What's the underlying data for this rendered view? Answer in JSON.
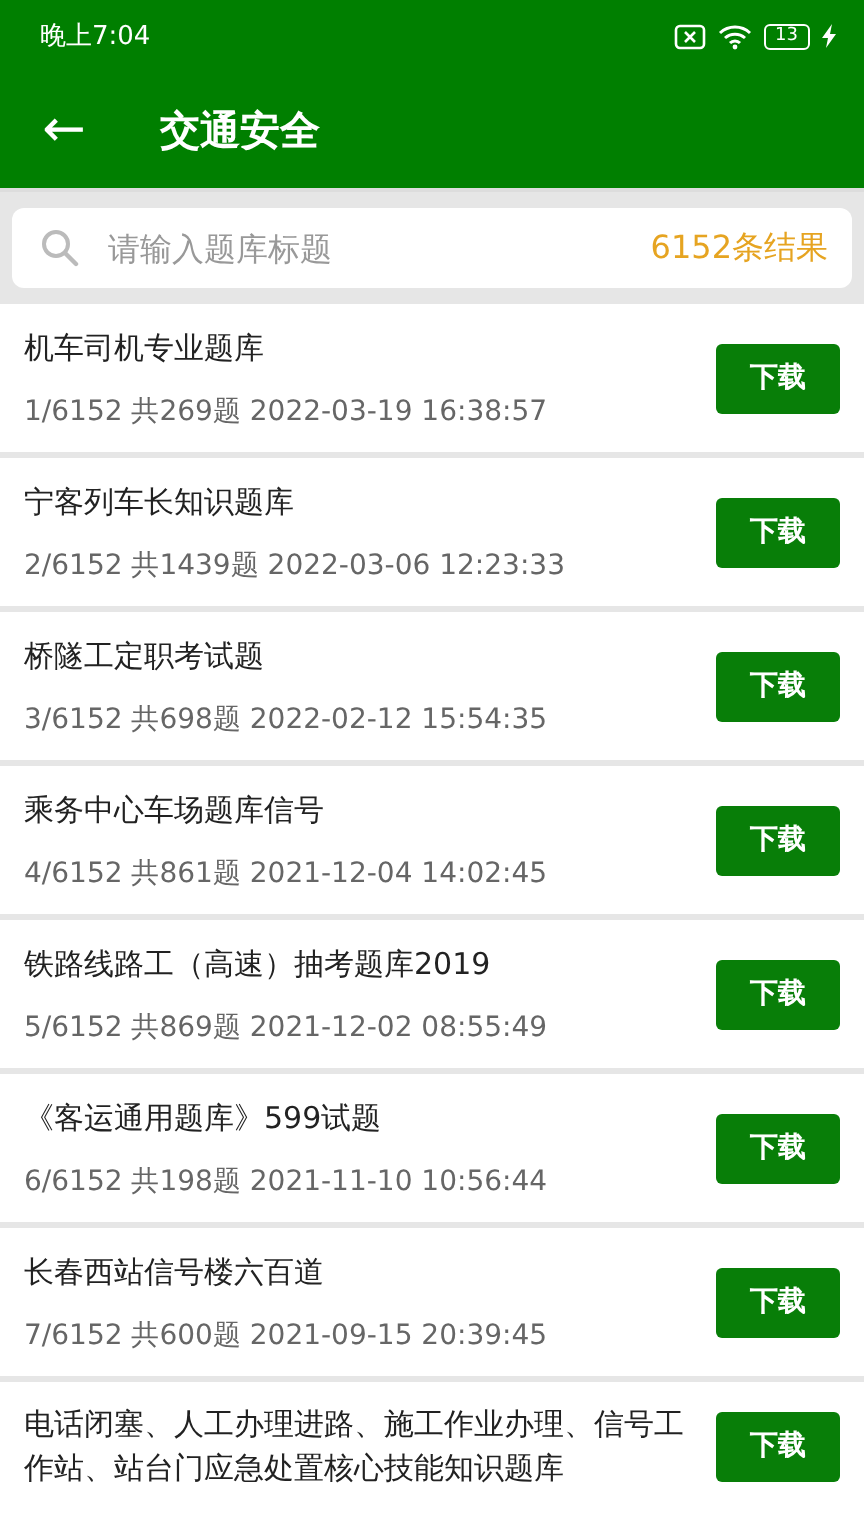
{
  "status_bar": {
    "time": "晚上7:04",
    "battery": "13"
  },
  "toolbar": {
    "back": "←",
    "title": "交通安全"
  },
  "search": {
    "placeholder": "请输入题库标题",
    "result_count": "6152条结果"
  },
  "items": [
    {
      "title": "机车司机专业题库",
      "meta": "1/6152 共269题  2022-03-19 16:38:57",
      "button": "下载"
    },
    {
      "title": "宁客列车长知识题库",
      "meta": "2/6152 共1439题  2022-03-06 12:23:33",
      "button": "下载"
    },
    {
      "title": "桥隧工定职考试题",
      "meta": "3/6152 共698题  2022-02-12 15:54:35",
      "button": "下载"
    },
    {
      "title": "乘务中心车场题库信号",
      "meta": "4/6152 共861题  2021-12-04 14:02:45",
      "button": "下载"
    },
    {
      "title": "铁路线路工（高速）抽考题库2019",
      "meta": "5/6152 共869题  2021-12-02 08:55:49",
      "button": "下载"
    },
    {
      "title": "《客运通用题库》599试题",
      "meta": "6/6152 共198题  2021-11-10 10:56:44",
      "button": "下载"
    },
    {
      "title": "长春西站信号楼六百道",
      "meta": "7/6152 共600题  2021-09-15 20:39:45",
      "button": "下载"
    },
    {
      "title": "电话闭塞、人工办理进路、施工作业办理、信号工作站、站台门应急处置核心技能知识题库",
      "button": "下载"
    }
  ]
}
